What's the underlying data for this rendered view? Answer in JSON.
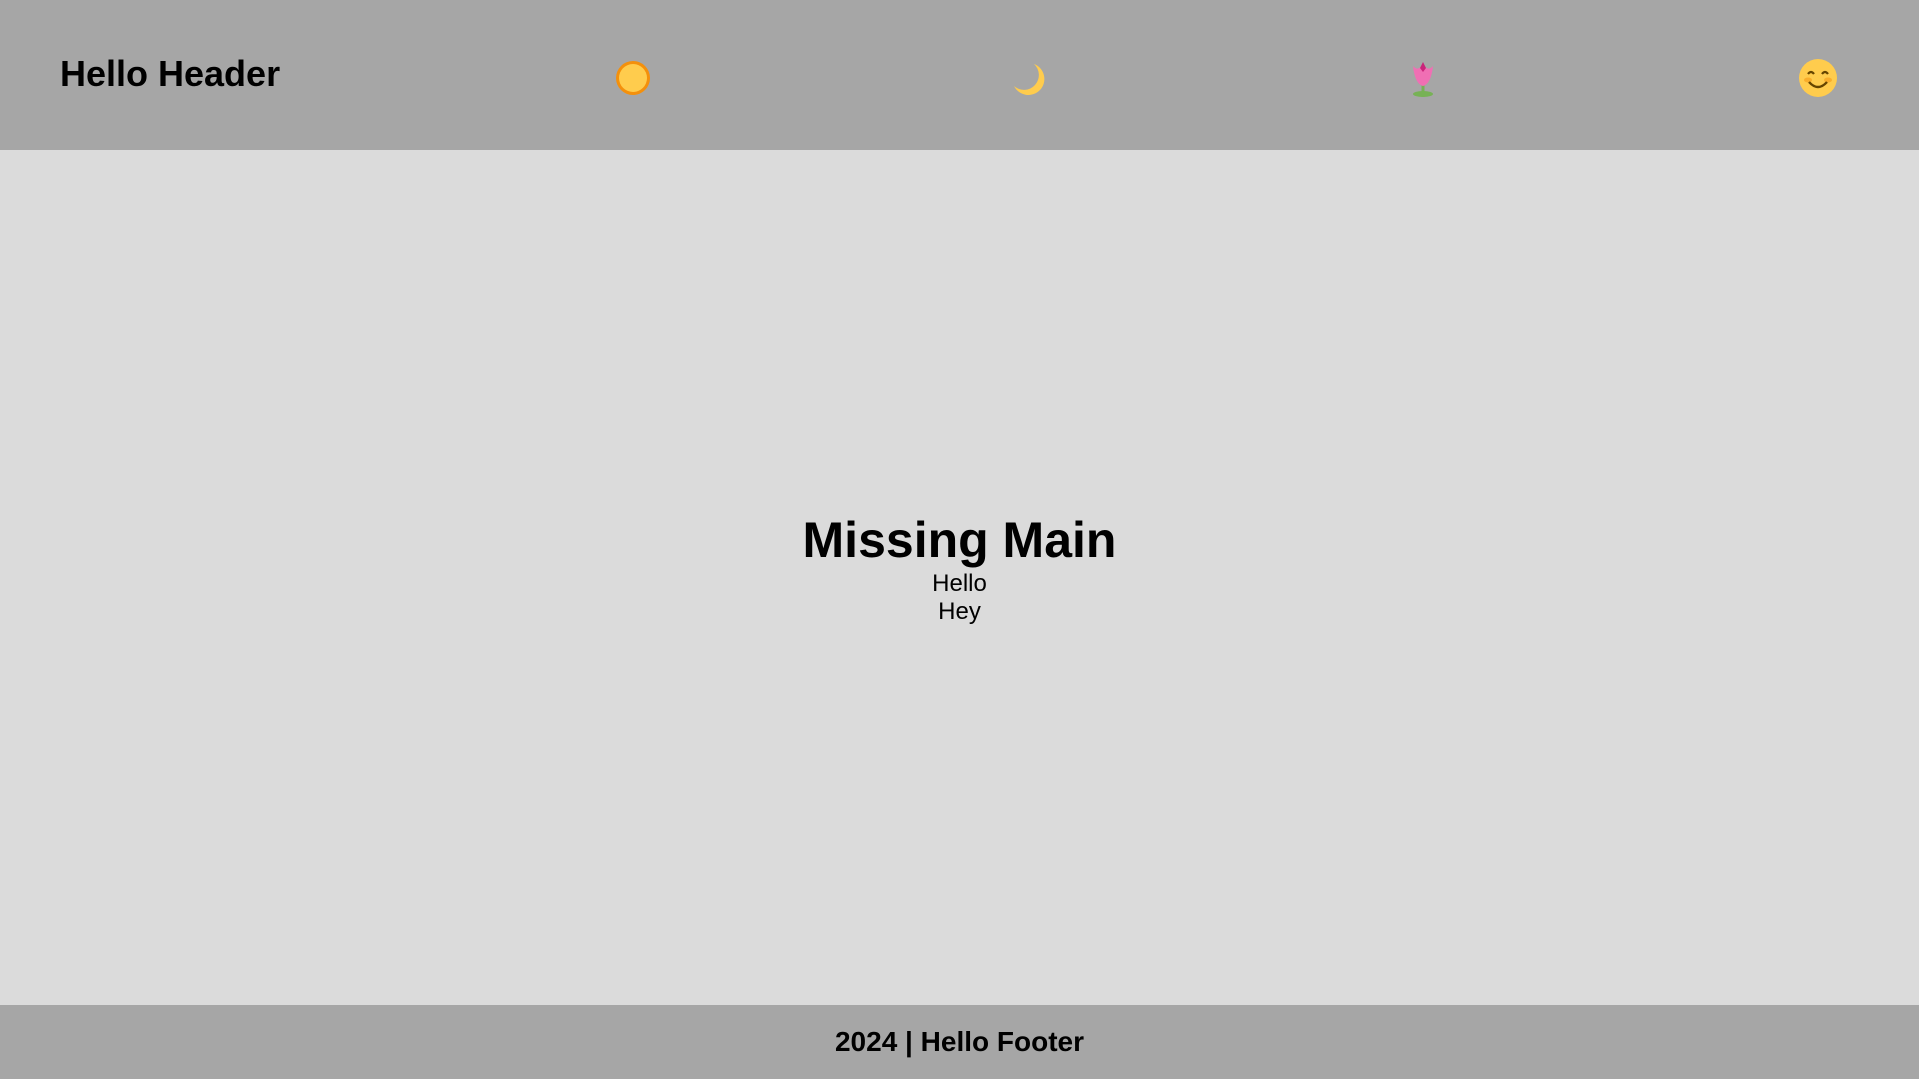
{
  "header": {
    "title": "Hello Header",
    "icons": [
      {
        "name": "sun-icon"
      },
      {
        "name": "crescent-moon-icon"
      },
      {
        "name": "tulip-icon"
      },
      {
        "name": "smiling-face-icon"
      }
    ],
    "background": "#a6a6a6"
  },
  "main": {
    "title": "Missing Main",
    "lines": [
      "Hello",
      "Hey"
    ],
    "background": "#dbdbdb"
  },
  "footer": {
    "text": "2024 | Hello Footer",
    "background": "#a6a6a6"
  }
}
